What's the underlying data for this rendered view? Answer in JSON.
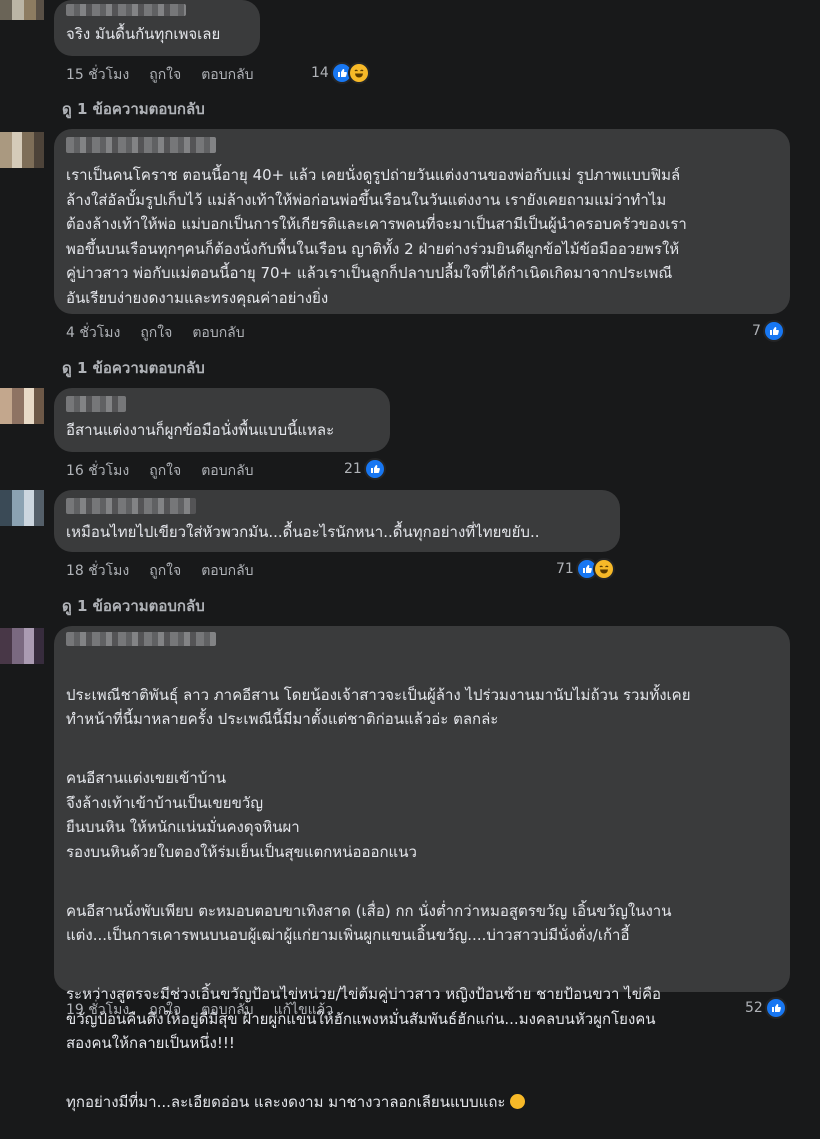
{
  "comments": [
    {
      "text": "จริง มันดื้นกันทุกเพจเลย",
      "time": "15 ชั่วโมง",
      "like": "ถูกใจ",
      "reply": "ตอบกลับ",
      "reaction_count": "14",
      "reactions": [
        "like-icon",
        "haha-icon"
      ],
      "replies_label": "ดู 1 ข้อความตอบกลับ"
    },
    {
      "text": "เราเป็นคนโคราช ตอนนี้อายุ 40+ แล้ว เคยนั่งดูรูปถ่ายวันแต่งงานของพ่อกับแม่ รูปภาพแบบฟิมล์\nล้างใส่อัลบั้มรูปเก็บไว้ แม่ล้างเท้าให้พ่อก่อนพ่อขึ้นเรือนในวันแต่งงาน เรายังเคยถามแม่ว่าทำไม\nต้องล้างเท้าให้พ่อ แม่บอกเป็นการให้เกียรติและเคารพคนที่จะมาเป็นสามีเป็นผู้นำครอบครัวของเรา\nพอขึ้นบนเรือนทุกๆคนก็ต้องนั่งกับพื้นในเรือน ญาติทั้ง 2 ฝ่ายต่างร่วมยินดีผูกข้อไม้ข้อมืออวยพรให้\nคู่บ่าวสาว พ่อกับแม่ตอนนี้อายุ 70+ แล้วเราเป็นลูกก็ปลาบปลื้มใจที่ได้กำเนิดเกิดมาจากประเพณี\nอันเรียบง่ายงดงามและทรงคุณค่าอย่างยิ่ง",
      "time": "4 ชั่วโมง",
      "like": "ถูกใจ",
      "reply": "ตอบกลับ",
      "reaction_count": "7",
      "reactions": [
        "like-icon"
      ],
      "replies_label": "ดู 1 ข้อความตอบกลับ"
    },
    {
      "text": "อีสานแต่งงานก็ผูกข้อมือนั่งพื้นแบบนี้แหละ",
      "time": "16 ชั่วโมง",
      "like": "ถูกใจ",
      "reply": "ตอบกลับ",
      "reaction_count": "21",
      "reactions": [
        "like-icon"
      ]
    },
    {
      "text": "เหมือนไทยไปเขียวใส่หัวพวกมัน...ดื้นอะไรนักหนา..ดื้นทุกอย่างที่ไทยขยับ..",
      "time": "18 ชั่วโมง",
      "like": "ถูกใจ",
      "reply": "ตอบกลับ",
      "reaction_count": "71",
      "reactions": [
        "like-icon",
        "haha-icon"
      ],
      "replies_label": "ดู 1 ข้อความตอบกลับ"
    },
    {
      "paragraphs": [
        "ประเพณีชาติพันธุ์ ลาว ภาคอีสาน โดยน้องเจ้าสาวจะเป็นผู้ล้าง ไปร่วมงานมานับไม่ถ้วน รวมทั้งเคย\nทำหน้าที่นี้มาหลายครั้ง ประเพณีนี้มีมาตั้งแต่ชาติก่อนแล้วอ่ะ ตลกล่ะ",
        "คนอีสานแต่งเขยเข้าบ้าน\nจึงล้างเท้าเข้าบ้านเป็นเขยขวัญ\nยืนบนหิน ให้หนักแน่นมั่นคงดุจหินผา\nรองบนหินด้วยใบตองให้ร่มเย็นเป็นสุขแตกหน่อออกแนว",
        "คนอีสานนั่งพับเพียบ ตะหมอบตอบขาเทิงสาด (เสื่อ) กก นั่งต่ำกว่าหมอสูตรขวัญ เอิ้นขวัญในงาน\nแต่ง...เป็นการเคารพนบนอบผู้เฒ่าผู้แก่ยามเพิ่นผูกแขนเอิ้นขวัญ....บ่าวสาวบ่มีนั่งตั่ง/เก้าอี้",
        "ระหว่างสูตรจะมีช่วงเอิ้นขวัญป้อนไข่หน่วย/ไข่ต้มคู่บ่าวสาว หญิงป้อนซ้าย ชายป้อนขวา ไข่คือ\nขวัญป้อนคืนดึงให้อยู่ดีมีสุข ฝ้ายผูกแขนให้ฮักแพงหมั่นสัมพันธ์ฮักแก่น...มงคลบนหัวผูกโยงคน\nสองคนให้กลายเป็นหนึ่ง!!!",
        "ทุกอย่างมีที่มา...ละเอียดอ่อน และงดงาม มาชางวาลอกเลียนแบบแถะ"
      ],
      "time": "19 ชั่วโมง",
      "like": "ถูกใจ",
      "reply": "ตอบกลับ",
      "edited": "แก้ไขแล้ว",
      "reaction_count": "52",
      "reactions": [
        "like-icon"
      ]
    }
  ],
  "colors": {
    "background": "#18191a",
    "bubble": "#3a3b3c",
    "text": "#e4e6eb",
    "secondary": "#b0b3b8",
    "like_blue": "#1877f2",
    "haha_yellow": "#f7b928"
  }
}
